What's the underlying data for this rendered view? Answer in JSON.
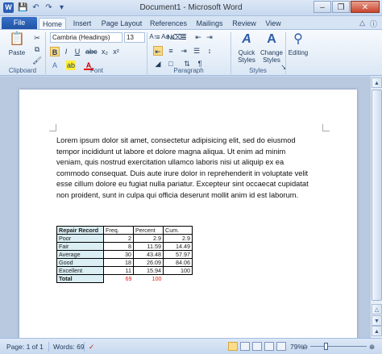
{
  "window": {
    "title": "Document1 - Microsoft Word",
    "app_letter": "W"
  },
  "tabs": {
    "file": "File",
    "items": [
      "Home",
      "Insert",
      "Page Layout",
      "References",
      "Mailings",
      "Review",
      "View"
    ],
    "active": "Home"
  },
  "ribbon": {
    "clipboard": {
      "label": "Clipboard",
      "paste": "Paste"
    },
    "font": {
      "label": "Font",
      "font_name": "Cambria (Headings)",
      "font_size": "13",
      "bold": "B",
      "italic": "I",
      "underline": "U",
      "font_color_letter": "A",
      "aa": "Aa"
    },
    "paragraph": {
      "label": "Paragraph"
    },
    "styles": {
      "label": "Styles",
      "quick_styles": "Quick Styles",
      "change_styles": "Change Styles"
    },
    "editing": {
      "label": "Editing"
    }
  },
  "document": {
    "paragraph": "Lorem ipsum dolor sit amet, consectetur adipisicing elit, sed do eiusmod tempor incididunt ut labore et dolore magna aliqua. Ut enim ad minim veniam, quis nostrud exercitation ullamco laboris nisi ut aliquip ex ea commodo consequat. Duis aute irure dolor in reprehenderit in voluptate velit esse cillum dolore eu fugiat nulla pariatur. Excepteur sint occaecat cupidatat non proident, sunt in culpa qui officia deserunt mollit anim id est laborum.",
    "table": {
      "headers": [
        "Repair Record",
        "Freq.",
        "Percent",
        "Cum."
      ],
      "rows": [
        [
          "Poor",
          "2",
          "2.9",
          "2.9"
        ],
        [
          "Fair",
          "8",
          "11.59",
          "14.49"
        ],
        [
          "Average",
          "30",
          "43.48",
          "57.97"
        ],
        [
          "Good",
          "18",
          "26.09",
          "84.06"
        ],
        [
          "Excellent",
          "11",
          "15.94",
          "100"
        ]
      ],
      "total": [
        "Total",
        "69",
        "100"
      ]
    }
  },
  "status": {
    "page": "Page: 1 of 1",
    "words": "Words: 69",
    "zoom": "79%",
    "zoom_fraction": 0.79
  }
}
